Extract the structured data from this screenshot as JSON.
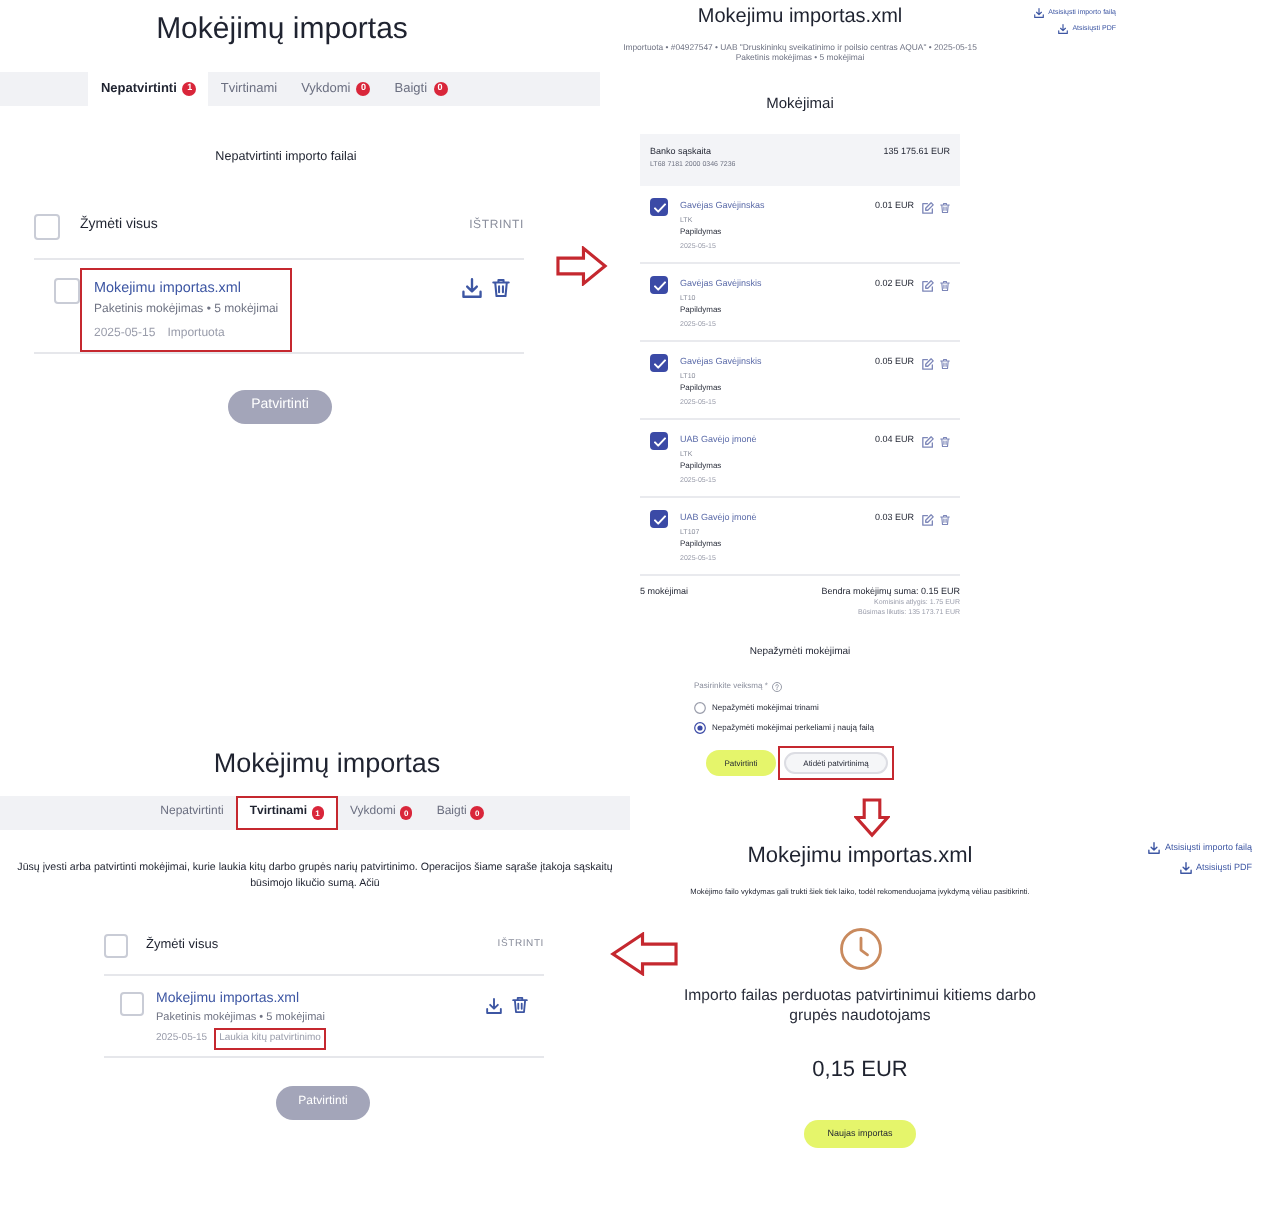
{
  "screens": [
    {
      "kind": "import_list",
      "title": "Mokėjimų importas",
      "tabs": [
        {
          "label": "Nepatvirtinti",
          "badge": "1",
          "selected": true,
          "highlighted": false
        },
        {
          "label": "Tvirtinami",
          "selected": false,
          "highlighted": false
        },
        {
          "label": "Vykdomi",
          "badge": "0",
          "selected": false,
          "highlighted": false
        },
        {
          "label": "Baigti",
          "badge": "0",
          "selected": false,
          "highlighted": false
        }
      ],
      "intro": "Nepatvirtinti importo failai",
      "select_all": {
        "label": "Žymėti visus",
        "checked": false
      },
      "delete_label": "IŠTRINTI",
      "files": [
        {
          "name": "Mokejimu importas.xml",
          "summary": "Paketinis mokėjimas • 5 mokėjimai",
          "date": "2025-05-15",
          "status": "Importuota",
          "checked": false,
          "highlighted": true,
          "status_highlighted": false
        }
      ],
      "confirm_button": {
        "label": "Patvirtinti",
        "disabled": true
      }
    },
    {
      "kind": "import_details",
      "title": "Mokejimu importas.xml",
      "links": [
        "Atsisiųsti importo failą",
        "Atsisiųsti PDF"
      ],
      "meta": [
        "Importuota • #04927547 • UAB \"Druskininkų sveikatinimo ir poilsio centras AQUA\" • 2025-05-15",
        "Paketinis mokėjimas • 5 mokėjimai"
      ],
      "section_title": "Mokėjimai",
      "account": {
        "label": "Banko sąskaita",
        "number": "LT68 7181 2000 0346 7236",
        "balance": "135 175.61 EUR"
      },
      "payments": [
        {
          "payee": "Gavėjas Gavėjinskas",
          "account": "LTK",
          "purpose": "Papildymas",
          "date": "2025-05-15",
          "amount": "0.01 EUR",
          "checked": true
        },
        {
          "payee": "Gavėjas Gavėjinskis",
          "account": "LT10",
          "purpose": "Papildymas",
          "date": "2025-05-15",
          "amount": "0.02 EUR",
          "checked": true
        },
        {
          "payee": "Gavėjas Gavėjinskis",
          "account": "LT10",
          "purpose": "Papildymas",
          "date": "2025-05-15",
          "amount": "0.05 EUR",
          "checked": true
        },
        {
          "payee": "UAB Gavėjo įmonė",
          "account": "LTK",
          "purpose": "Papildymas",
          "date": "2025-05-15",
          "amount": "0.04 EUR",
          "checked": true
        },
        {
          "payee": "UAB Gavėjo įmonė",
          "account": "LT107",
          "purpose": "Papildymas",
          "date": "2025-05-15",
          "amount": "0.03 EUR",
          "checked": true
        }
      ],
      "summary": {
        "count": "5 mokėjimai",
        "total": "Bendra mokėjimų suma: 0.15 EUR",
        "fee": "Komisinis atlygis: 1.75 EUR",
        "future_balance": "Būsimas likutis: 135 173.71 EUR"
      },
      "unmarked": {
        "title": "Nepažymėti mokėjimai",
        "prompt": "Pasirinkite veiksmą *",
        "options": [
          {
            "label": "Nepažymėti mokėjimai trinami",
            "selected": false
          },
          {
            "label": "Nepažymėti mokėjimai perkeliami į naują failą",
            "selected": true
          }
        ]
      },
      "buttons": [
        {
          "label": "Patvirtinti",
          "kind": "primary",
          "highlighted": false
        },
        {
          "label": "Atidėti patvirtinimą",
          "kind": "secondary",
          "highlighted": true
        }
      ]
    },
    {
      "kind": "import_list",
      "title": "Mokėjimų importas",
      "tabs": [
        {
          "label": "Nepatvirtinti",
          "selected": false,
          "highlighted": false
        },
        {
          "label": "Tvirtinami",
          "badge": "1",
          "selected": true,
          "highlighted": true
        },
        {
          "label": "Vykdomi",
          "badge": "0",
          "selected": false,
          "highlighted": false
        },
        {
          "label": "Baigti",
          "badge": "0",
          "selected": false,
          "highlighted": false
        }
      ],
      "intro": "Jūsų įvesti arba patvirtinti mokėjimai, kurie laukia kitų darbo grupės narių patvirtinimo. Operacijos šiame sąraše įtakoja sąskaitų būsimojo likučio sumą. Ačiū",
      "select_all": {
        "label": "Žymėti visus",
        "checked": false
      },
      "delete_label": "IŠTRINTI",
      "files": [
        {
          "name": "Mokejimu importas.xml",
          "summary": "Paketinis mokėjimas • 5 mokėjimai",
          "date": "2025-05-15",
          "status": "Laukia kitų patvirtinimo",
          "checked": false,
          "highlighted": false,
          "status_highlighted": true
        }
      ],
      "confirm_button": {
        "label": "Patvirtinti",
        "disabled": true
      }
    },
    {
      "kind": "import_result",
      "title": "Mokejimu importas.xml",
      "links": [
        "Atsisiųsti importo failą",
        "Atsisiųsti PDF"
      ],
      "note": "Mokėjimo failo vykdymas gali trukti šiek tiek laiko, todėl rekomenduojama įvykdymą vėliau pasitikrinti.",
      "message": "Importo failas perduotas patvirtinimui kitiems darbo grupės naudotojams",
      "amount": "0,15 EUR",
      "button": "Naujas importas"
    }
  ],
  "annotation_arrows": [
    {
      "kind": "right"
    },
    {
      "kind": "down"
    },
    {
      "kind": "left"
    }
  ]
}
